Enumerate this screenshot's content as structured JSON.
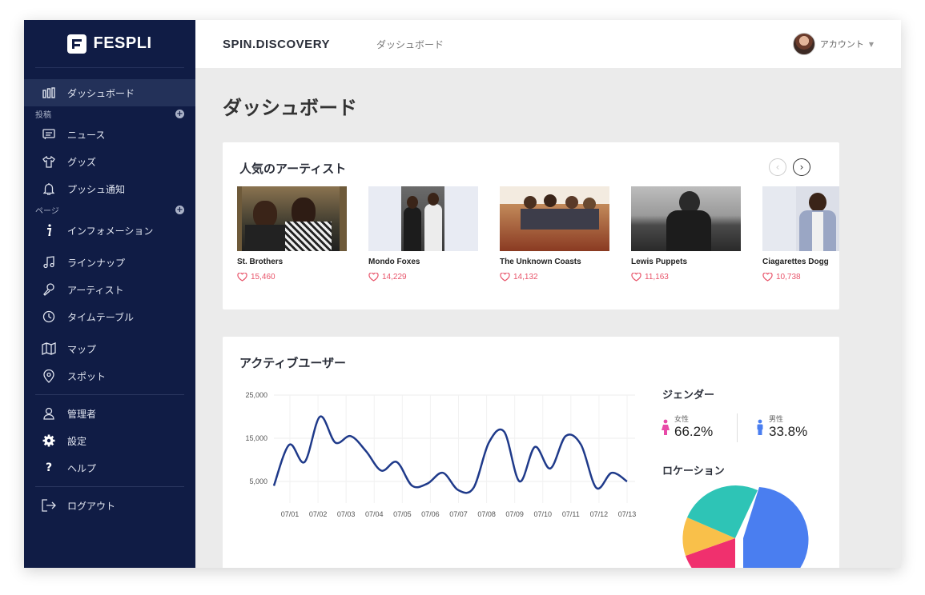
{
  "brand": {
    "name": "FESPLI"
  },
  "sidebar": {
    "top_item": {
      "label": "ダッシュボード",
      "icon": "bar-chart-icon"
    },
    "section_posts": "投稿",
    "posts": [
      {
        "label": "ニュース",
        "icon": "news-icon"
      },
      {
        "label": "グッズ",
        "icon": "tshirt-icon"
      },
      {
        "label": "プッシュ通知",
        "icon": "bell-icon"
      }
    ],
    "section_pages": "ページ",
    "pages": [
      {
        "label": "インフォメーション",
        "icon": "info-icon"
      },
      {
        "label": "ラインナップ",
        "icon": "music-note-icon"
      },
      {
        "label": "アーティスト",
        "icon": "microphone-icon"
      },
      {
        "label": "タイムテーブル",
        "icon": "clock-icon"
      },
      {
        "label": "マップ",
        "icon": "map-icon"
      },
      {
        "label": "スポット",
        "icon": "pin-icon"
      }
    ],
    "admin": [
      {
        "label": "管理者",
        "icon": "user-icon"
      },
      {
        "label": "設定",
        "icon": "gear-icon"
      },
      {
        "label": "ヘルプ",
        "icon": "question-icon"
      }
    ],
    "logout": {
      "label": "ログアウト",
      "icon": "logout-icon"
    }
  },
  "header": {
    "site": "SPIN.DISCOVERY",
    "link": "ダッシュボード",
    "account": "アカウント"
  },
  "page_title": "ダッシュボード",
  "artists_card": {
    "title": "人気のアーティスト",
    "artists": [
      {
        "name": "St. Brothers",
        "likes": "15,460"
      },
      {
        "name": "Mondo Foxes",
        "likes": "14,229"
      },
      {
        "name": "The Unknown Coasts",
        "likes": "14,132"
      },
      {
        "name": "Lewis Puppets",
        "likes": "11,163"
      },
      {
        "name": "Ciagarettes Dogg",
        "likes": "10,738"
      }
    ]
  },
  "users_card": {
    "title": "アクティブユーザー",
    "gender_title": "ジェンダー",
    "female": {
      "label": "女性",
      "value": "66.2%"
    },
    "male": {
      "label": "男性",
      "value": "33.8%"
    },
    "location_title": "ロケーション"
  },
  "colors": {
    "sidebar_bg": "#101c45",
    "line": "#1f3a8a",
    "female": "#e84aa8",
    "male": "#4a7ef0",
    "pie": [
      "#4a7ef0",
      "#2ec4b6",
      "#f9c04a",
      "#f0306e"
    ]
  },
  "chart_data": {
    "type": "line",
    "x": [
      "07/01",
      "07/02",
      "07/03",
      "07/04",
      "07/05",
      "07/06",
      "07/07",
      "07/08",
      "07/09",
      "07/10",
      "07/11",
      "07/12",
      "07/13"
    ],
    "series": [
      {
        "values": [
          4000,
          13500,
          9500,
          20000,
          14000,
          15500,
          12000,
          7500,
          9500,
          4000,
          4500,
          7000,
          3000,
          3500,
          14000,
          16500,
          5000,
          13000,
          8000,
          15500,
          13500,
          3500,
          7000,
          5000
        ]
      }
    ],
    "ylim": [
      0,
      25000
    ],
    "yticks": [
      "25,000",
      "15,000",
      "5,000"
    ],
    "ytick_values": [
      25000,
      15000,
      5000
    ],
    "grid": true
  }
}
